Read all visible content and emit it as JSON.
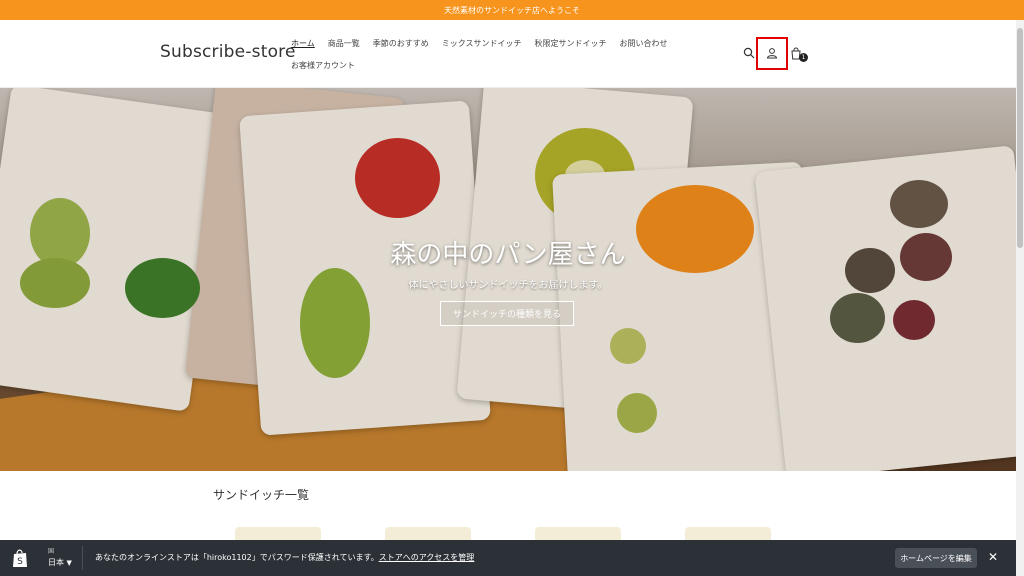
{
  "announcement": "天然素材のサンドイッチ店へようこそ",
  "header": {
    "logo": "Subscribe-store",
    "nav": [
      {
        "label": "ホーム",
        "active": true
      },
      {
        "label": "商品一覧"
      },
      {
        "label": "季節のおすすめ"
      },
      {
        "label": "ミックスサンドイッチ"
      },
      {
        "label": "秋限定サンドイッチ"
      },
      {
        "label": "お問い合わせ"
      },
      {
        "label": "お客様アカウント"
      }
    ],
    "cart_count": "1"
  },
  "hero": {
    "title": "森の中のパン屋さん",
    "subtitle": "体にやさしいサンドイッチをお届けします。",
    "button": "サンドイッチの種類を見る"
  },
  "section": {
    "title": "サンドイッチ一覧"
  },
  "admin_bar": {
    "country_label": "国",
    "country_value": "日本",
    "message_prefix": "あなたのオンラインストアは「hiroko1102」でパスワード保護されています。",
    "message_link": "ストアへのアクセスを管理",
    "edit_button": "ホームページを編集",
    "close": "✕"
  },
  "colors": {
    "accent": "#f7941d",
    "admin_bar": "#2c3137",
    "highlight": "#e20000"
  }
}
